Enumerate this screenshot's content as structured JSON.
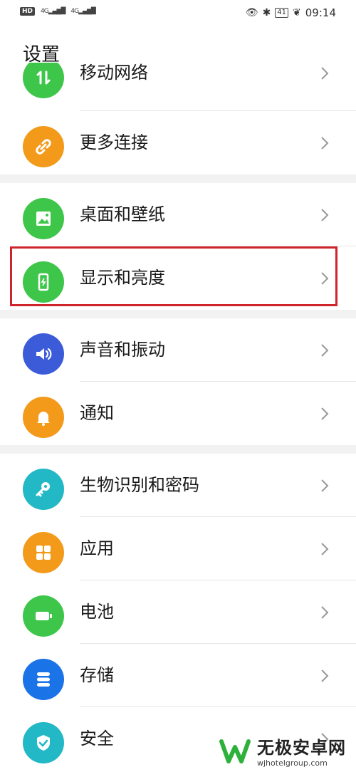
{
  "status_bar": {
    "hd": "HD",
    "signal1": "4G",
    "signal2": "4G",
    "battery": "41",
    "time": "09:14"
  },
  "page": {
    "title": "设置"
  },
  "items": [
    {
      "label": "移动网络",
      "icon": "mobile-network-icon",
      "color": "#3ec64a"
    },
    {
      "label": "更多连接",
      "icon": "link-icon",
      "color": "#f39a1b"
    },
    {
      "label": "桌面和壁纸",
      "icon": "image-icon",
      "color": "#3ec64a"
    },
    {
      "label": "显示和亮度",
      "icon": "phone-brightness-icon",
      "color": "#3ec64a"
    },
    {
      "label": "声音和振动",
      "icon": "speaker-icon",
      "color": "#3b5bd9"
    },
    {
      "label": "通知",
      "icon": "bell-icon",
      "color": "#f39a1b"
    },
    {
      "label": "生物识别和密码",
      "icon": "key-icon",
      "color": "#22b8c6"
    },
    {
      "label": "应用",
      "icon": "apps-grid-icon",
      "color": "#f39a1b"
    },
    {
      "label": "电池",
      "icon": "battery-icon",
      "color": "#3ec64a"
    },
    {
      "label": "存储",
      "icon": "storage-icon",
      "color": "#1b73e8"
    },
    {
      "label": "安全",
      "icon": "shield-icon",
      "color": "#22b8c6"
    }
  ],
  "watermark": {
    "name": "无极安卓网",
    "url": "wjhotelgroup.com",
    "color": "#2db13b"
  }
}
